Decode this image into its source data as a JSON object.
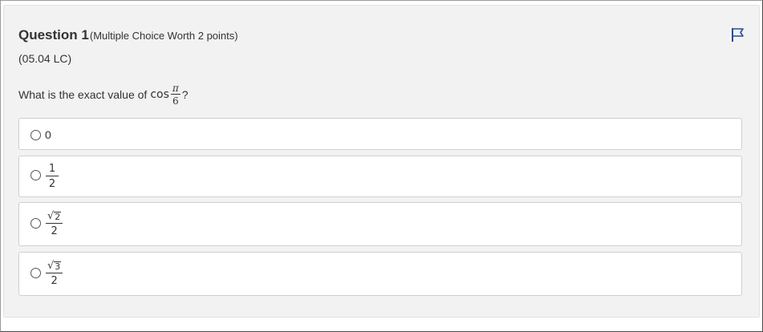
{
  "question": {
    "title": "Question 1",
    "meta": "(Multiple Choice Worth 2 points)",
    "code": "(05.04 LC)",
    "prompt_text": "What is the exact value of",
    "prompt_function": "cos",
    "prompt_fraction": {
      "numerator": "π",
      "denominator": "6"
    },
    "prompt_end": "?",
    "flag_icon": "flag-icon"
  },
  "options": [
    {
      "label": "0"
    },
    {
      "numerator": "1",
      "denominator": "2"
    },
    {
      "radical": "√",
      "radicand": "2",
      "denominator": "2"
    },
    {
      "radical": "√",
      "radicand": "3",
      "denominator": "2"
    }
  ]
}
